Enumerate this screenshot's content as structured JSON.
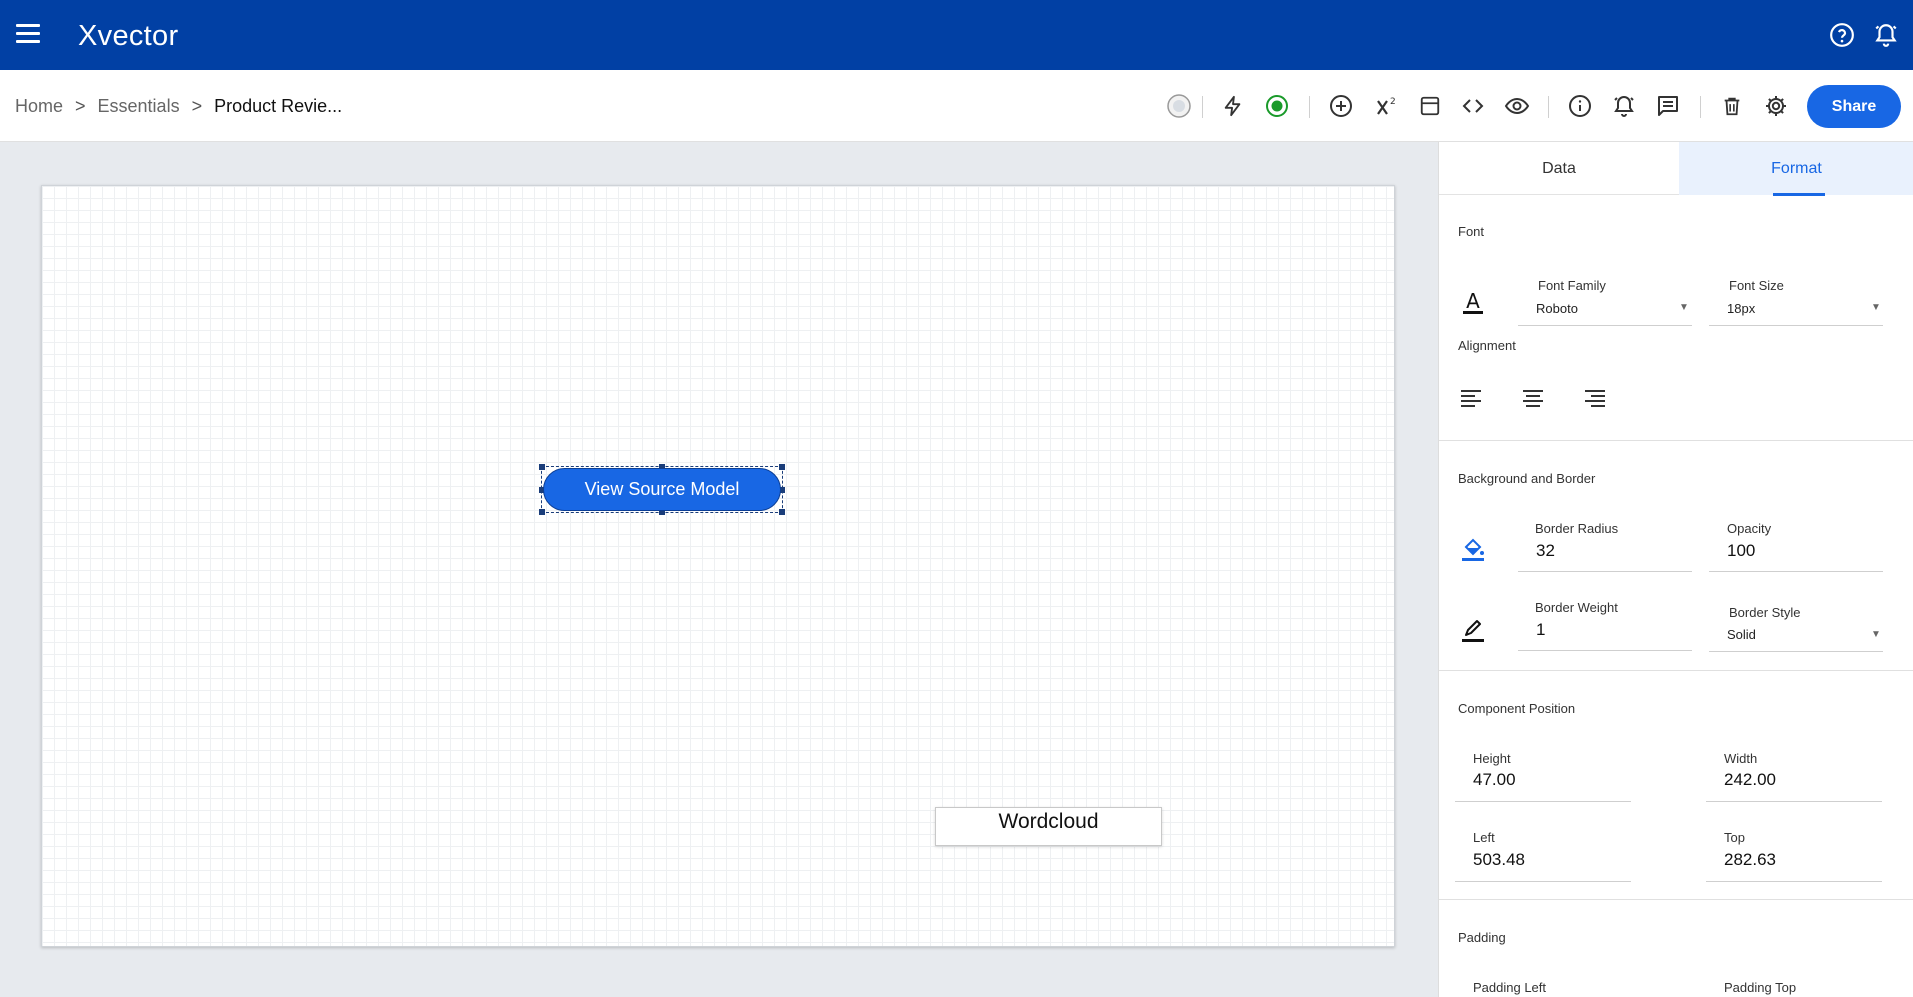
{
  "app": {
    "logo": "Xvector"
  },
  "breadcrumb": {
    "home": "Home",
    "sep": ">",
    "essentials": "Essentials",
    "current": "Product Revie..."
  },
  "toolbar": {
    "share_label": "Share"
  },
  "canvas": {
    "button_label": "View Source Model",
    "wordcloud_label": "Wordcloud"
  },
  "panel": {
    "tabs": [
      {
        "label": "Data"
      },
      {
        "label": "Format"
      }
    ],
    "font": {
      "title": "Font",
      "family_label": "Font Family",
      "family_value": "Roboto",
      "size_label": "Font Size",
      "size_value": "18px",
      "alignment_label": "Alignment"
    },
    "background": {
      "title": "Background and Border",
      "radius_label": "Border Radius",
      "radius_value": "32",
      "opacity_label": "Opacity",
      "opacity_value": "100",
      "weight_label": "Border Weight",
      "weight_value": "1",
      "style_label": "Border Style",
      "style_value": "Solid"
    },
    "position": {
      "title": "Component Position",
      "height_label": "Height",
      "height_value": "47.00",
      "width_label": "Width",
      "width_value": "242.00",
      "left_label": "Left",
      "left_value": "503.48",
      "top_label": "Top",
      "top_value": "282.63"
    },
    "padding": {
      "title": "Padding",
      "left_label": "Padding Left",
      "top_label": "Padding Top"
    }
  },
  "colors": {
    "topbar": "#0140a4",
    "accent": "#1867e4",
    "status_green": "#1a9a2a"
  }
}
